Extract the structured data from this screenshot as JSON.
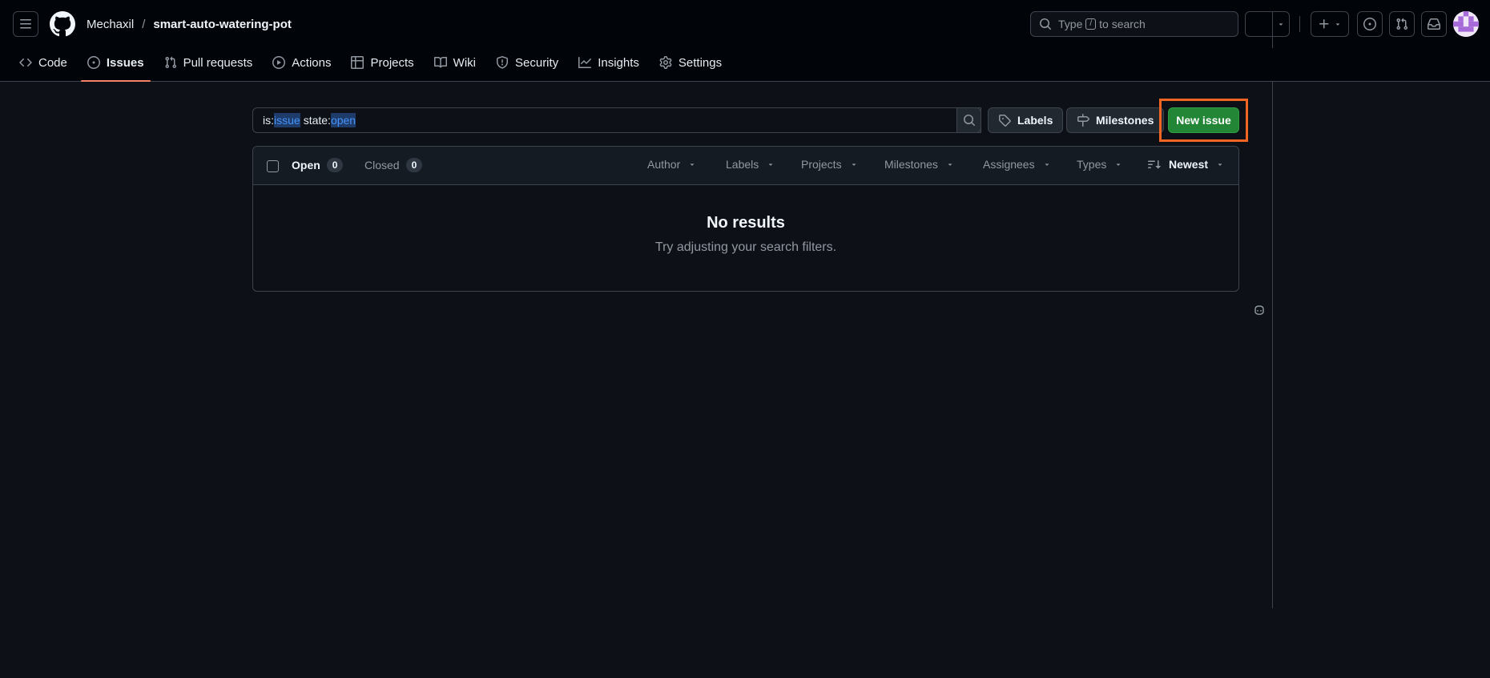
{
  "header": {
    "owner": "Mechaxil",
    "separator": "/",
    "repo": "smart-auto-watering-pot",
    "search_prefix": "Type",
    "search_key": "/",
    "search_suffix": "to search"
  },
  "repo_nav": {
    "tabs": [
      {
        "label": "Code",
        "icon": "code-icon"
      },
      {
        "label": "Issues",
        "icon": "issue-opened-icon",
        "selected": true
      },
      {
        "label": "Pull requests",
        "icon": "git-pull-request-icon"
      },
      {
        "label": "Actions",
        "icon": "play-icon"
      },
      {
        "label": "Projects",
        "icon": "table-icon"
      },
      {
        "label": "Wiki",
        "icon": "book-icon"
      },
      {
        "label": "Security",
        "icon": "shield-icon"
      },
      {
        "label": "Insights",
        "icon": "graph-icon"
      },
      {
        "label": "Settings",
        "icon": "gear-icon"
      }
    ]
  },
  "filter": {
    "q1_key": "is:",
    "q1_val": "issue",
    "q2_key": "state:",
    "q2_val": "open"
  },
  "actions": {
    "labels": "Labels",
    "milestones": "Milestones",
    "new_issue": "New issue"
  },
  "list_header": {
    "open_label": "Open",
    "open_count": "0",
    "closed_label": "Closed",
    "closed_count": "0",
    "filters": [
      "Author",
      "Labels",
      "Projects",
      "Milestones",
      "Assignees",
      "Types"
    ],
    "sort": "Newest"
  },
  "blankslate": {
    "title": "No results",
    "subtitle": "Try adjusting your search filters."
  },
  "colors": {
    "accent_underline": "#f78166",
    "primary_button": "#238636",
    "highlight_box": "#f26522",
    "link_blue": "#4493f8"
  }
}
